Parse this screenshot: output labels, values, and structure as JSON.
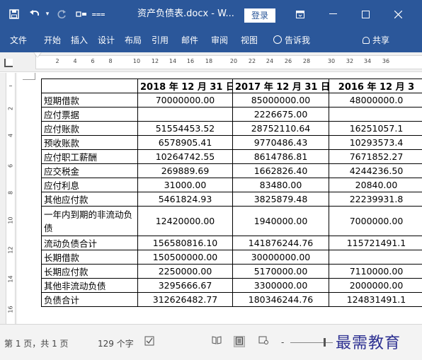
{
  "titlebar": {
    "save_icon": "save-icon",
    "undo_icon": "undo-icon",
    "redo_icon": "redo-icon",
    "format_icon": "format-painter-icon",
    "qat_icon": "customize-qat-icon",
    "title": "资产负债表.docx - W...",
    "login_label": "登录",
    "ribbon_display_icon": "ribbon-display-icon",
    "minimize_icon": "minimize-icon",
    "maximize_icon": "maximize-icon",
    "close_icon": "close-icon",
    "background": "#2b579a"
  },
  "ribbon": {
    "tabs": [
      "文件",
      "开始",
      "插入",
      "设计",
      "布局",
      "引用",
      "邮件",
      "审阅",
      "视图"
    ],
    "tell_me": "告诉我",
    "share": "共享"
  },
  "ruler": {
    "marks": [
      "2",
      "4",
      "6",
      "8",
      "10",
      "12",
      "14",
      "16",
      "18",
      "20",
      "22",
      "24",
      "26",
      "28",
      "30",
      "32",
      "34",
      "36"
    ]
  },
  "vruler": {
    "marks": [
      "2",
      "4",
      "6",
      "8",
      "10",
      "12",
      "14",
      "16"
    ]
  },
  "table": {
    "headers": [
      "",
      "2018 年 12 月 31 日",
      "2017 年 12 月 31 日",
      "2016 年 12 月 3"
    ],
    "rows": [
      {
        "label": "短期借款",
        "v2018": "70000000.00",
        "v2017": "85000000.00",
        "v2016": "48000000.0"
      },
      {
        "label": "应付票据",
        "v2018": "",
        "v2017": "2226675.00",
        "v2016": ""
      },
      {
        "label": "应付账款",
        "v2018": "51554453.52",
        "v2017": "28752110.64",
        "v2016": "16251057.1"
      },
      {
        "label": "预收账款",
        "v2018": "6578905.41",
        "v2017": "9770486.43",
        "v2016": "10293573.4"
      },
      {
        "label": "应付职工薪酬",
        "v2018": "10264742.55",
        "v2017": "8614786.81",
        "v2016": "7671852.27"
      },
      {
        "label": "应交税金",
        "v2018": "269889.69",
        "v2017": "1662826.40",
        "v2016": "4244236.50"
      },
      {
        "label": "应付利息",
        "v2018": "31000.00",
        "v2017": "83480.00",
        "v2016": "20840.00"
      },
      {
        "label": "其他应付款",
        "v2018": "5461824.93",
        "v2017": "3825879.48",
        "v2016": "22239931.8"
      },
      {
        "label": "一年内到期的非流动负债",
        "v2018": "12420000.00",
        "v2017": "1940000.00",
        "v2016": "7000000.00"
      },
      {
        "label": "流动负债合计",
        "v2018": "156580816.10",
        "v2017": "141876244.76",
        "v2016": "115721491.1"
      },
      {
        "label": "长期借款",
        "v2018": "150500000.00",
        "v2017": "30000000.00",
        "v2016": ""
      },
      {
        "label": "长期应付款",
        "v2018": "2250000.00",
        "v2017": "5170000.00",
        "v2016": "7110000.00"
      },
      {
        "label": "其他非流动负债",
        "v2018": "3295666.67",
        "v2017": "3300000.00",
        "v2016": "2000000.00"
      },
      {
        "label": "负债合计",
        "v2018": "312626482.77",
        "v2017": "180346244.76",
        "v2016": "124831491.1"
      }
    ]
  },
  "statusbar": {
    "page_info": "第 1 页，共 1 页",
    "word_count": "129 个字",
    "proofing_icon": "proofing-icon",
    "read_mode_icon": "read-mode-icon",
    "print_layout_icon": "print-layout-icon",
    "web_layout_icon": "web-layout-icon",
    "zoom_out": "-",
    "watermark": "最需教育"
  }
}
